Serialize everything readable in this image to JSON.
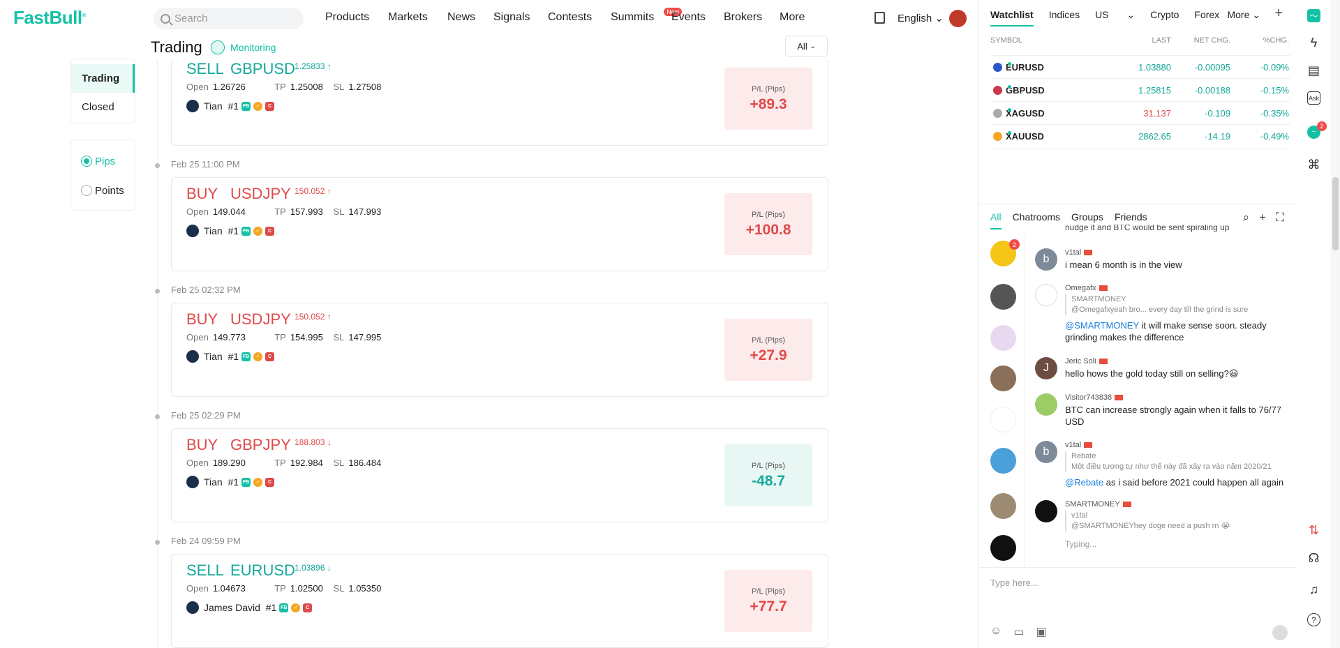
{
  "brand": {
    "name": "FastBull"
  },
  "search": {
    "placeholder": "Search"
  },
  "nav": {
    "items": [
      "Products",
      "Markets",
      "News",
      "Signals",
      "Contests",
      "Summits",
      "Events",
      "Brokers",
      "More"
    ],
    "new_badge": "New",
    "language": "English"
  },
  "page": {
    "title": "Trading",
    "monitoring": "Monitoring",
    "filter": "All"
  },
  "side_tabs": {
    "trading": "Trading",
    "closed": "Closed"
  },
  "units": {
    "pips": "Pips",
    "points": "Points"
  },
  "pl_label": "P/L (Pips)",
  "labels": {
    "open": "Open",
    "tp": "TP",
    "sl": "SL"
  },
  "trades": [
    {
      "date": "",
      "side": "SELL",
      "symbol": "GBPUSD",
      "price": "1.25833",
      "dir": "up",
      "open": "1.26726",
      "tp": "1.25008",
      "sl": "1.27508",
      "user": "Tian",
      "rank": "#1",
      "pl": "+89.3",
      "pl_type": "pos"
    },
    {
      "date": "Feb 25 11:00 PM",
      "side": "BUY",
      "symbol": "USDJPY",
      "price": "150.052",
      "dir": "up",
      "open": "149.044",
      "tp": "157.993",
      "sl": "147.993",
      "user": "Tian",
      "rank": "#1",
      "pl": "+100.8",
      "pl_type": "pos"
    },
    {
      "date": "Feb 25 02:32 PM",
      "side": "BUY",
      "symbol": "USDJPY",
      "price": "150.052",
      "dir": "up",
      "open": "149.773",
      "tp": "154.995",
      "sl": "147.995",
      "user": "Tian",
      "rank": "#1",
      "pl": "+27.9",
      "pl_type": "pos"
    },
    {
      "date": "Feb 25 02:29 PM",
      "side": "BUY",
      "symbol": "GBPJPY",
      "price": "188.803",
      "dir": "down",
      "open": "189.290",
      "tp": "192.984",
      "sl": "186.484",
      "user": "Tian",
      "rank": "#1",
      "pl": "-48.7",
      "pl_type": "neg"
    },
    {
      "date": "Feb 24 09:59 PM",
      "side": "SELL",
      "symbol": "EURUSD",
      "price": "1.03896",
      "dir": "down",
      "open": "1.04673",
      "tp": "1.02500",
      "sl": "1.05350",
      "user": "James David",
      "rank": "#1",
      "pl": "+77.7",
      "pl_type": "pos"
    }
  ],
  "watchlist": {
    "tabs": [
      "Watchlist",
      "Indices",
      "US",
      "Crypto",
      "Forex"
    ],
    "more": "More",
    "headers": {
      "symbol": "SYMBOL",
      "last": "LAST",
      "net": "NET CHG.",
      "pct": "%CHG."
    },
    "rows": [
      {
        "symbol": "EURUSD",
        "last": "1.03880",
        "net": "-0.00095",
        "pct": "-0.09%",
        "last_color": "#15a89a"
      },
      {
        "symbol": "GBPUSD",
        "last": "1.25815",
        "net": "-0.00188",
        "pct": "-0.15%",
        "last_color": "#15a89a"
      },
      {
        "symbol": "XAGUSD",
        "last": "31.137",
        "net": "-0.109",
        "pct": "-0.35%",
        "last_color": "#e04a4a"
      },
      {
        "symbol": "XAUUSD",
        "last": "2862.65",
        "net": "-14.19",
        "pct": "-0.49%",
        "last_color": "#15a89a"
      }
    ]
  },
  "chat": {
    "tabs": [
      "All",
      "Chatrooms",
      "Groups",
      "Friends"
    ],
    "cut_text": "nudge it and BTC would be sent spiraling up",
    "sidebar_badge": "2",
    "messages": [
      {
        "user": "v1tal",
        "initial": "b",
        "quote_user": "",
        "quote": "",
        "text": "i mean 6 month is in the view",
        "mention": ""
      },
      {
        "user": "Omegafx",
        "initial": "",
        "quote_user": "SMARTMONEY",
        "quote": "@Omegafxyeah bro... every day till the grind is sure",
        "text": " it will make sense soon. steady grinding makes the difference",
        "mention": "@SMARTMONEY"
      },
      {
        "user": "Jeric Soli",
        "initial": "J",
        "quote_user": "",
        "quote": "",
        "text": "hello hows the gold today still on selling?😃",
        "mention": ""
      },
      {
        "user": "Visitor743838",
        "initial": "",
        "quote_user": "",
        "quote": "",
        "text": "BTC can increase strongly again when it falls to 76/77 USD",
        "mention": ""
      },
      {
        "user": "v1tal",
        "initial": "b",
        "quote_user": "Rebate",
        "quote": "Một điều tương tự như thế này đã xảy ra vào năm 2020/21",
        "text": " as i said before 2021 could happen all again",
        "mention": "@Rebate"
      },
      {
        "user": "SMARTMONEY",
        "initial": "",
        "quote_user": "v1tal",
        "quote": "@SMARTMONEYhey doge need a push rn 😭",
        "text": "",
        "mention": ""
      }
    ],
    "typing": "Typing...",
    "input_placeholder": "Type here..."
  },
  "rail": {
    "badge": "2",
    "ask": "Ask"
  }
}
